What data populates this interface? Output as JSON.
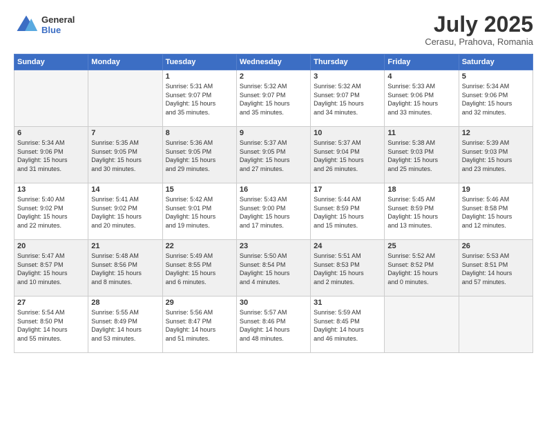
{
  "header": {
    "logo_line1": "General",
    "logo_line2": "Blue",
    "month_title": "July 2025",
    "subtitle": "Cerasu, Prahova, Romania"
  },
  "weekdays": [
    "Sunday",
    "Monday",
    "Tuesday",
    "Wednesday",
    "Thursday",
    "Friday",
    "Saturday"
  ],
  "weeks": [
    [
      {
        "day": "",
        "empty": true
      },
      {
        "day": "",
        "empty": true
      },
      {
        "day": "1",
        "info": "Sunrise: 5:31 AM\nSunset: 9:07 PM\nDaylight: 15 hours\nand 35 minutes."
      },
      {
        "day": "2",
        "info": "Sunrise: 5:32 AM\nSunset: 9:07 PM\nDaylight: 15 hours\nand 35 minutes."
      },
      {
        "day": "3",
        "info": "Sunrise: 5:32 AM\nSunset: 9:07 PM\nDaylight: 15 hours\nand 34 minutes."
      },
      {
        "day": "4",
        "info": "Sunrise: 5:33 AM\nSunset: 9:06 PM\nDaylight: 15 hours\nand 33 minutes."
      },
      {
        "day": "5",
        "info": "Sunrise: 5:34 AM\nSunset: 9:06 PM\nDaylight: 15 hours\nand 32 minutes."
      }
    ],
    [
      {
        "day": "6",
        "info": "Sunrise: 5:34 AM\nSunset: 9:06 PM\nDaylight: 15 hours\nand 31 minutes."
      },
      {
        "day": "7",
        "info": "Sunrise: 5:35 AM\nSunset: 9:05 PM\nDaylight: 15 hours\nand 30 minutes."
      },
      {
        "day": "8",
        "info": "Sunrise: 5:36 AM\nSunset: 9:05 PM\nDaylight: 15 hours\nand 29 minutes."
      },
      {
        "day": "9",
        "info": "Sunrise: 5:37 AM\nSunset: 9:05 PM\nDaylight: 15 hours\nand 27 minutes."
      },
      {
        "day": "10",
        "info": "Sunrise: 5:37 AM\nSunset: 9:04 PM\nDaylight: 15 hours\nand 26 minutes."
      },
      {
        "day": "11",
        "info": "Sunrise: 5:38 AM\nSunset: 9:03 PM\nDaylight: 15 hours\nand 25 minutes."
      },
      {
        "day": "12",
        "info": "Sunrise: 5:39 AM\nSunset: 9:03 PM\nDaylight: 15 hours\nand 23 minutes."
      }
    ],
    [
      {
        "day": "13",
        "info": "Sunrise: 5:40 AM\nSunset: 9:02 PM\nDaylight: 15 hours\nand 22 minutes."
      },
      {
        "day": "14",
        "info": "Sunrise: 5:41 AM\nSunset: 9:02 PM\nDaylight: 15 hours\nand 20 minutes."
      },
      {
        "day": "15",
        "info": "Sunrise: 5:42 AM\nSunset: 9:01 PM\nDaylight: 15 hours\nand 19 minutes."
      },
      {
        "day": "16",
        "info": "Sunrise: 5:43 AM\nSunset: 9:00 PM\nDaylight: 15 hours\nand 17 minutes."
      },
      {
        "day": "17",
        "info": "Sunrise: 5:44 AM\nSunset: 8:59 PM\nDaylight: 15 hours\nand 15 minutes."
      },
      {
        "day": "18",
        "info": "Sunrise: 5:45 AM\nSunset: 8:59 PM\nDaylight: 15 hours\nand 13 minutes."
      },
      {
        "day": "19",
        "info": "Sunrise: 5:46 AM\nSunset: 8:58 PM\nDaylight: 15 hours\nand 12 minutes."
      }
    ],
    [
      {
        "day": "20",
        "info": "Sunrise: 5:47 AM\nSunset: 8:57 PM\nDaylight: 15 hours\nand 10 minutes."
      },
      {
        "day": "21",
        "info": "Sunrise: 5:48 AM\nSunset: 8:56 PM\nDaylight: 15 hours\nand 8 minutes."
      },
      {
        "day": "22",
        "info": "Sunrise: 5:49 AM\nSunset: 8:55 PM\nDaylight: 15 hours\nand 6 minutes."
      },
      {
        "day": "23",
        "info": "Sunrise: 5:50 AM\nSunset: 8:54 PM\nDaylight: 15 hours\nand 4 minutes."
      },
      {
        "day": "24",
        "info": "Sunrise: 5:51 AM\nSunset: 8:53 PM\nDaylight: 15 hours\nand 2 minutes."
      },
      {
        "day": "25",
        "info": "Sunrise: 5:52 AM\nSunset: 8:52 PM\nDaylight: 15 hours\nand 0 minutes."
      },
      {
        "day": "26",
        "info": "Sunrise: 5:53 AM\nSunset: 8:51 PM\nDaylight: 14 hours\nand 57 minutes."
      }
    ],
    [
      {
        "day": "27",
        "info": "Sunrise: 5:54 AM\nSunset: 8:50 PM\nDaylight: 14 hours\nand 55 minutes."
      },
      {
        "day": "28",
        "info": "Sunrise: 5:55 AM\nSunset: 8:49 PM\nDaylight: 14 hours\nand 53 minutes."
      },
      {
        "day": "29",
        "info": "Sunrise: 5:56 AM\nSunset: 8:47 PM\nDaylight: 14 hours\nand 51 minutes."
      },
      {
        "day": "30",
        "info": "Sunrise: 5:57 AM\nSunset: 8:46 PM\nDaylight: 14 hours\nand 48 minutes."
      },
      {
        "day": "31",
        "info": "Sunrise: 5:59 AM\nSunset: 8:45 PM\nDaylight: 14 hours\nand 46 minutes."
      },
      {
        "day": "",
        "empty": true
      },
      {
        "day": "",
        "empty": true
      }
    ]
  ]
}
